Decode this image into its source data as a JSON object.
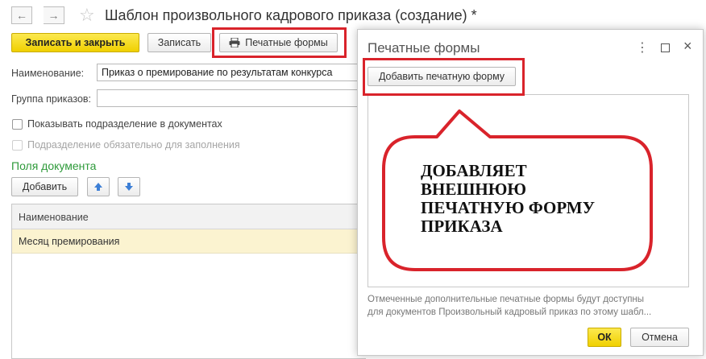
{
  "window": {
    "title": "Шаблон произвольного кадрового приказа (создание) *"
  },
  "toolbar": {
    "save_close_label": "Записать и закрыть",
    "save_label": "Записать",
    "print_forms_label": "Печатные формы"
  },
  "form": {
    "name_label": "Наименование:",
    "name_value": "Приказ о премирование по результатам конкурса",
    "group_label": "Группа приказов:",
    "group_value": "",
    "show_department_label": "Показывать подразделение в документах",
    "department_required_label": "Подразделение обязательно для заполнения",
    "fields_section_title": "Поля документа",
    "add_label": "Добавить"
  },
  "table": {
    "header_name": "Наименование",
    "rows": [
      {
        "name": "Месяц премирования"
      }
    ]
  },
  "dialog": {
    "title": "Печатные формы",
    "add_form_label": "Добавить печатную форму",
    "callout_text": "ДОБАВЛЯЕТ ВНЕШНЮЮ ПЕЧАТНУЮ ФОРМУ ПРИКАЗА",
    "info_text_line1": "Отмеченные дополнительные печатные формы будут доступны",
    "info_text_line2": "для документов Произвольный кадровый приказ по этому шабл...",
    "ok_label": "ОК",
    "cancel_label": "Отмена"
  },
  "colors": {
    "primary_yellow": "#f5dc1e",
    "section_green": "#2e9a3a",
    "highlight_red": "#d9232b",
    "row_selected": "#fbf3d0"
  }
}
